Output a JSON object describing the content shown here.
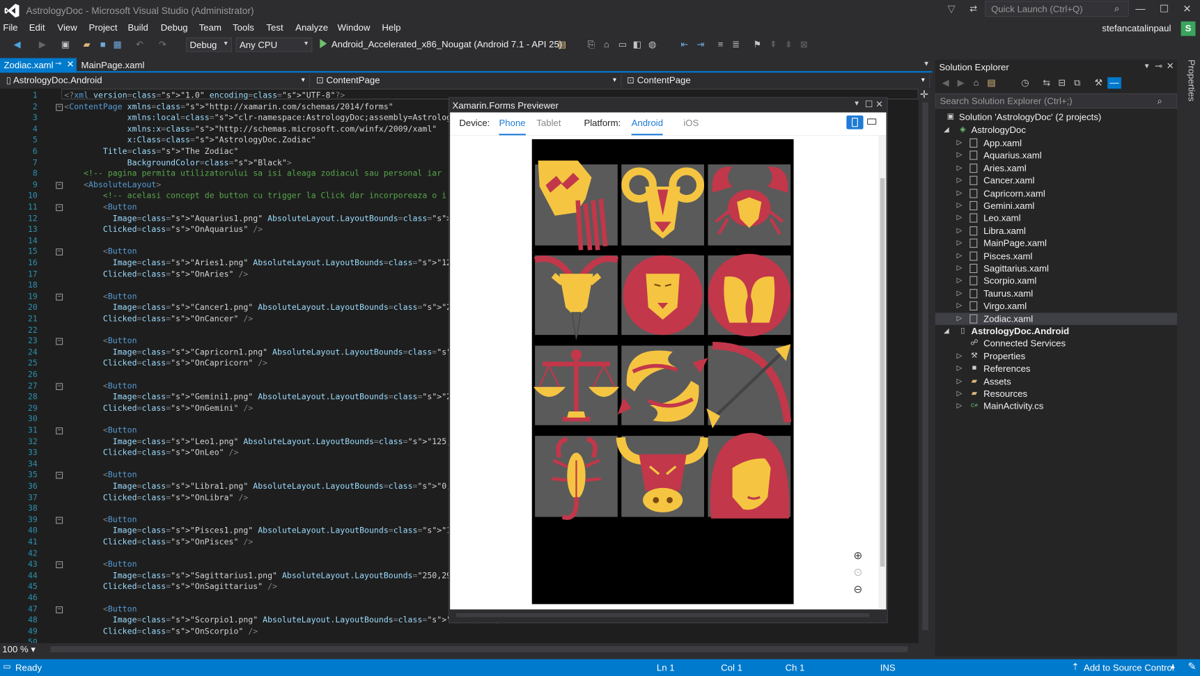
{
  "window": {
    "title": "AstrologyDoc - Microsoft Visual Studio  (Administrator)",
    "quick_launch_placeholder": "Quick Launch (Ctrl+Q)",
    "user": "stefancatalinpaul",
    "user_initial": "S"
  },
  "menu": [
    "File",
    "Edit",
    "View",
    "Project",
    "Build",
    "Debug",
    "Team",
    "Tools",
    "Test",
    "Analyze",
    "Window",
    "Help"
  ],
  "toolbar": {
    "config": "Debug",
    "platform": "Any CPU",
    "run_target": "Android_Accelerated_x86_Nougat (Android 7.1 - API 25)"
  },
  "doc_tabs": [
    {
      "label": "Zodiac.xaml",
      "active": true
    },
    {
      "label": "MainPage.xaml",
      "active": false
    }
  ],
  "nav": {
    "project": "AstrologyDoc.Android",
    "scope1": "ContentPage",
    "scope2": "ContentPage"
  },
  "editor": {
    "line_numbers": [
      "1",
      "2",
      "3",
      "4",
      "5",
      "6",
      "7",
      "8",
      "9",
      "10",
      "11",
      "12",
      "13",
      "14",
      "15",
      "16",
      "17",
      "18",
      "19",
      "20",
      "21",
      "22",
      "23",
      "24",
      "25",
      "26",
      "27",
      "28",
      "29",
      "30",
      "31",
      "32",
      "33",
      "34",
      "35",
      "36",
      "37",
      "38",
      "39",
      "40",
      "41",
      "42",
      "43",
      "44",
      "45",
      "46",
      "47",
      "48",
      "49",
      "50"
    ],
    "lines": [
      "<?xml version=\"1.0\" encoding=\"UTF-8\"?>",
      "<ContentPage xmlns=\"http://xamarin.com/schemas/2014/forms\"",
      "             xmlns:local=\"clr-namespace:AstrologyDoc;assembly=AstrologyDoc\"",
      "             xmlns:x=\"http://schemas.microsoft.com/winfx/2009/xaml\"",
      "             x:Class=\"AstrologyDoc.Zodiac\"",
      "        Title=\"The Zodiac\"",
      "             BackgroundColor=\"Black\">",
      "    <!-- pagina permita utilizatorului sa isi aleaga zodiacul sau personal iar",
      "    <AbsoluteLayout>",
      "        <!-- acelasi concept de button cu trigger la Click dar incorporeaza o i",
      "        <Button",
      "          Image=\"Aquarius1.png\" AbsoluteLayout.LayoutBounds=\"0,30,128,128\" Is",
      "        Clicked=\"OnAquarius\" />",
      "",
      "        <Button",
      "          Image=\"Aries1.png\" AbsoluteLayout.LayoutBounds=\"125,30,128,128\" IsE",
      "        Clicked=\"OnAries\" />",
      "",
      "        <Button",
      "          Image=\"Cancer1.png\" AbsoluteLayout.LayoutBounds=\"250,30,125,128\" Is",
      "        Clicked=\"OnCancer\" />",
      "",
      "        <Button",
      "          Image=\"Capricorn1.png\" AbsoluteLayout.LayoutBounds=\"0,160,128,128\"",
      "        Clicked=\"OnCapricorn\" />",
      "",
      "        <Button",
      "          Image=\"Gemini1.png\" AbsoluteLayout.LayoutBounds=\"247,160,128,128\" I",
      "        Clicked=\"OnGemini\" />",
      "",
      "        <Button",
      "          Image=\"Leo1.png\" AbsoluteLayout.LayoutBounds=\"125,160,125,128\" IsEn",
      "        Clicked=\"OnLeo\" />",
      "",
      "        <Button",
      "          Image=\"Libra1.png\" AbsoluteLayout.LayoutBounds=\"0,290,128,128\" IsEn",
      "        Clicked=\"OnLibra\" />",
      "",
      "        <Button",
      "          Image=\"Pisces1.png\" AbsoluteLayout.LayoutBounds=\"125,290,128,128\" I",
      "        Clicked=\"OnPisces\" />",
      "",
      "        <Button",
      "          Image=\"Sagittarius1.png\" AbsoluteLayout.LayoutBounds=\"250,290,125,1",
      "        Clicked=\"OnSagittarius\" />",
      "",
      "        <Button",
      "          Image=\"Scorpio1.png\" AbsoluteLayout.LayoutBounds=\"0,420,128,128\" Is",
      "        Clicked=\"OnScorpio\" />",
      ""
    ],
    "zoom": "100 %"
  },
  "previewer": {
    "title": "Xamarin.Forms Previewer",
    "device_label": "Device:",
    "device_options": [
      "Phone",
      "Tablet"
    ],
    "device_selected": "Phone",
    "platform_label": "Platform:",
    "platform_options": [
      "Android",
      "iOS"
    ],
    "platform_selected": "Android",
    "tiles": [
      "aquarius-icon",
      "aries-icon",
      "cancer-icon",
      "capricorn-icon",
      "leo-icon",
      "gemini-icon",
      "libra-icon",
      "pisces-icon",
      "sagittarius-icon",
      "scorpio-icon",
      "taurus-icon",
      "virgo-icon"
    ],
    "colors": {
      "tile_bg": "#5a5a5a",
      "gold": "#f5c542",
      "red": "#c2374a"
    }
  },
  "solution_explorer": {
    "title": "Solution Explorer",
    "search_placeholder": "Search Solution Explorer (Ctrl+;)",
    "solution": "Solution 'AstrologyDoc' (2 projects)",
    "project1": "AstrologyDoc",
    "files": [
      "App.xaml",
      "Aquarius.xaml",
      "Aries.xaml",
      "Cancer.xaml",
      "Capricorn.xaml",
      "Gemini.xaml",
      "Leo.xaml",
      "Libra.xaml",
      "MainPage.xaml",
      "Pisces.xaml",
      "Sagittarius.xaml",
      "Scorpio.xaml",
      "Taurus.xaml",
      "Virgo.xaml",
      "Zodiac.xaml"
    ],
    "project2": "AstrologyDoc.Android",
    "android_items": [
      "Connected Services",
      "Properties",
      "References",
      "Assets",
      "Resources",
      "MainActivity.cs"
    ],
    "properties_tab": "Properties"
  },
  "status": {
    "ready": "Ready",
    "ln": "Ln 1",
    "col": "Col 1",
    "ch": "Ch 1",
    "mode": "INS",
    "source_control": "Add to Source Control"
  }
}
